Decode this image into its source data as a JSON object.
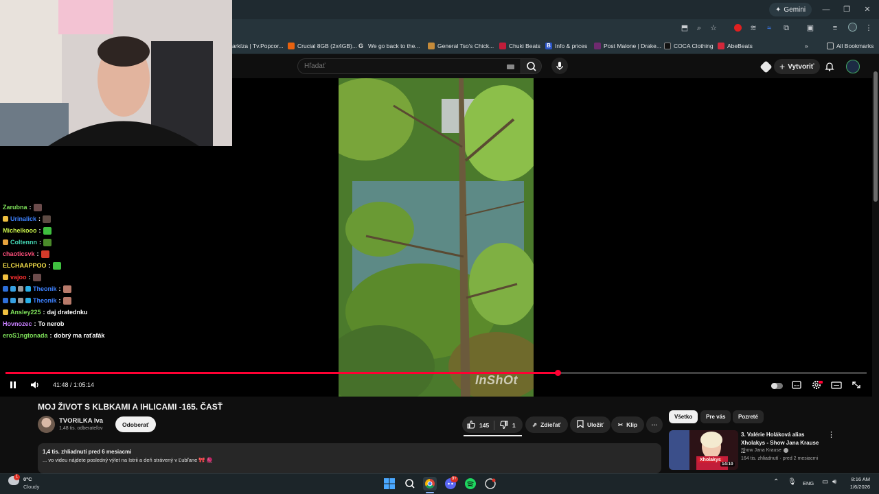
{
  "browser": {
    "gemini_label": "Gemini",
    "bookmarks": [
      {
        "label": "arkíza | Tv.Popcor...",
        "color": "#1f1f1f"
      },
      {
        "label": "Crucial 8GB (2x4GB)...",
        "color": "#e8620f"
      },
      {
        "label": "We go back to the...",
        "color": "#9aa0a6"
      },
      {
        "label": "General Tso's Chick...",
        "color": "#c58b3a"
      },
      {
        "label": "Chuki Beats",
        "color": "#c21d3a"
      },
      {
        "label": "Info & prices",
        "color": "#2b55c7"
      },
      {
        "label": "Post Malone | Drake...",
        "color": "#6e2a6f"
      },
      {
        "label": "COCA Clothing",
        "color": "#111111"
      },
      {
        "label": "AbeBeats",
        "color": "#d3283b"
      }
    ],
    "all_bookmarks_label": "All Bookmarks"
  },
  "youtube": {
    "search_placeholder": "Hľadať",
    "create_label": "Vytvoriť"
  },
  "chat": [
    {
      "user": "Zarubna",
      "message": "",
      "color": "#7ee05a",
      "emote": "#6b4b4b",
      "badges": []
    },
    {
      "user": "Urinalick",
      "message": "",
      "color": "#3d82ff",
      "emote": "#5d4a43",
      "badges": [
        "#f0c040"
      ]
    },
    {
      "user": "Michelkooo",
      "message": "",
      "color": "#c7f04a",
      "emote": "#3fbf3f",
      "badges": []
    },
    {
      "user": "Coltennn",
      "message": "",
      "color": "#44d6b4",
      "emote": "#4a8a2a",
      "badges": [
        "#e8a33d"
      ]
    },
    {
      "user": "chaoticsvk",
      "message": "",
      "color": "#ff4f7b",
      "emote": "#d23b2a",
      "badges": []
    },
    {
      "user": "ELCHAAPPOO",
      "message": "",
      "color": "#f5e04a",
      "emote": "#3fbf3f",
      "badges": []
    },
    {
      "user": "vajoo",
      "message": "",
      "color": "#ff3030",
      "emote": "#6b4b4b",
      "badges": [
        "#f0c040"
      ]
    },
    {
      "user": "Theonik",
      "message": "",
      "color": "#3d82ff",
      "emote": "#b87a6a",
      "badges": [
        "#2e6fd8",
        "#37a0e0",
        "#999999",
        "#28b0e8"
      ]
    },
    {
      "user": "Theonik",
      "message": "",
      "color": "#3d82ff",
      "emote": "#b87a6a",
      "badges": [
        "#2e6fd8",
        "#37a0e0",
        "#999999",
        "#28b0e8"
      ]
    },
    {
      "user": "Ansley225",
      "message": "daj dratednku",
      "color": "#7ee05a",
      "emote": "",
      "badges": [
        "#f0c040"
      ]
    },
    {
      "user": "Hovnozec",
      "message": "To nerob",
      "color": "#c880ff",
      "emote": "",
      "badges": []
    },
    {
      "user": "eroS1ngtonada",
      "message": "dobrý ma raťafák",
      "color": "#7ee05a",
      "emote": "",
      "badges": []
    }
  ],
  "player": {
    "time_display": "41:48 / 1:05:14",
    "progress_fraction": 0.641,
    "watermark": "InShOt"
  },
  "video": {
    "title": "MOJ ŽIVOT S KLBKAMI A IHLICAMI -165. ČASŤ",
    "channel": "TVORILKA Iva",
    "subscribers": "1,48 tis. odberateľov",
    "unsubscribe_label": "Odoberať",
    "likes": "145",
    "dislikes": "1",
    "share_label": "Zdieľať",
    "save_label": "Uložiť",
    "clip_label": "Klip",
    "description_meta": "1,4 tis. zhliadnutí  pred 6 mesiacmi",
    "description_text": "... vo videu nájdete posledný výlet na Istrii a deň strávený v Ľubľane 🎀 🧶"
  },
  "sidebar": {
    "chips": [
      "Všetko",
      "Pre vás",
      "Pozreté"
    ],
    "recommendation": {
      "title": "3. Valérie Holáková alias Xholakys - Show Jana Krause ...",
      "channel": "Show Jana Krause",
      "meta": "164 tis. zhliadnutí · pred 2 mesiacmi",
      "duration": "14:10",
      "thumb_caption": "Xholakys"
    }
  },
  "taskbar": {
    "weather_temp": "0°C",
    "weather_desc": "Cloudy",
    "weather_badge": "1",
    "language": "ENG",
    "time": "8:16 AM",
    "date": "1/6/2026",
    "discord_badge": "9+"
  }
}
